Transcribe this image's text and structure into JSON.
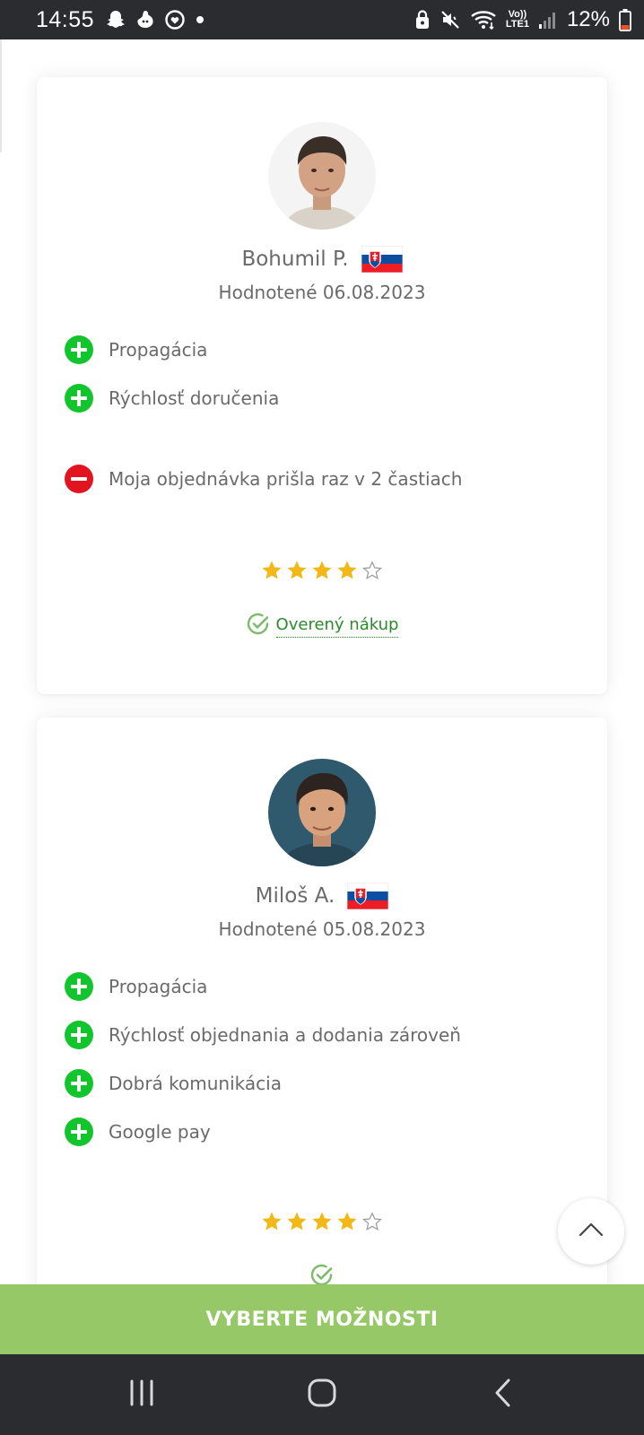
{
  "status_bar": {
    "time": "14:55",
    "battery_percent": "12%",
    "icons_left": [
      "snapchat-icon",
      "ghost-icon",
      "camera-heart-icon",
      "dot-icon"
    ],
    "icons_right": [
      "lock-icon",
      "mute-icon",
      "wifi-icon",
      "volte-icon",
      "signal-icon",
      "battery-icon"
    ],
    "volte_label_top": "Vo))",
    "volte_label_bottom": "LTE1"
  },
  "reviews": [
    {
      "name": "Bohumil P.",
      "country_flag": "slovakia-flag",
      "date": "Hodnotené 06.08.2023",
      "pros": [
        "Propagácia",
        "Rýchlosť doručenia"
      ],
      "cons": [
        "Moja objednávka prišla raz v 2 častiach"
      ],
      "rating": 4,
      "rating_max": 5,
      "verified_label": "Overený nákup"
    },
    {
      "name": "Miloš A.",
      "country_flag": "slovakia-flag",
      "date": "Hodnotené 05.08.2023",
      "pros": [
        "Propagácia",
        "Rýchlosť objednania a dodania zároveň",
        "Dobrá komunikácia",
        "Google pay"
      ],
      "cons": [],
      "rating": 4,
      "rating_max": 5,
      "verified_label": ""
    }
  ],
  "cta": {
    "label": "VYBERTE MOŽNOSTI"
  },
  "colors": {
    "pro": "#13c52c",
    "con": "#e11420",
    "star": "#f2b818",
    "cta": "#96c867",
    "verified": "#2a8b2a"
  }
}
